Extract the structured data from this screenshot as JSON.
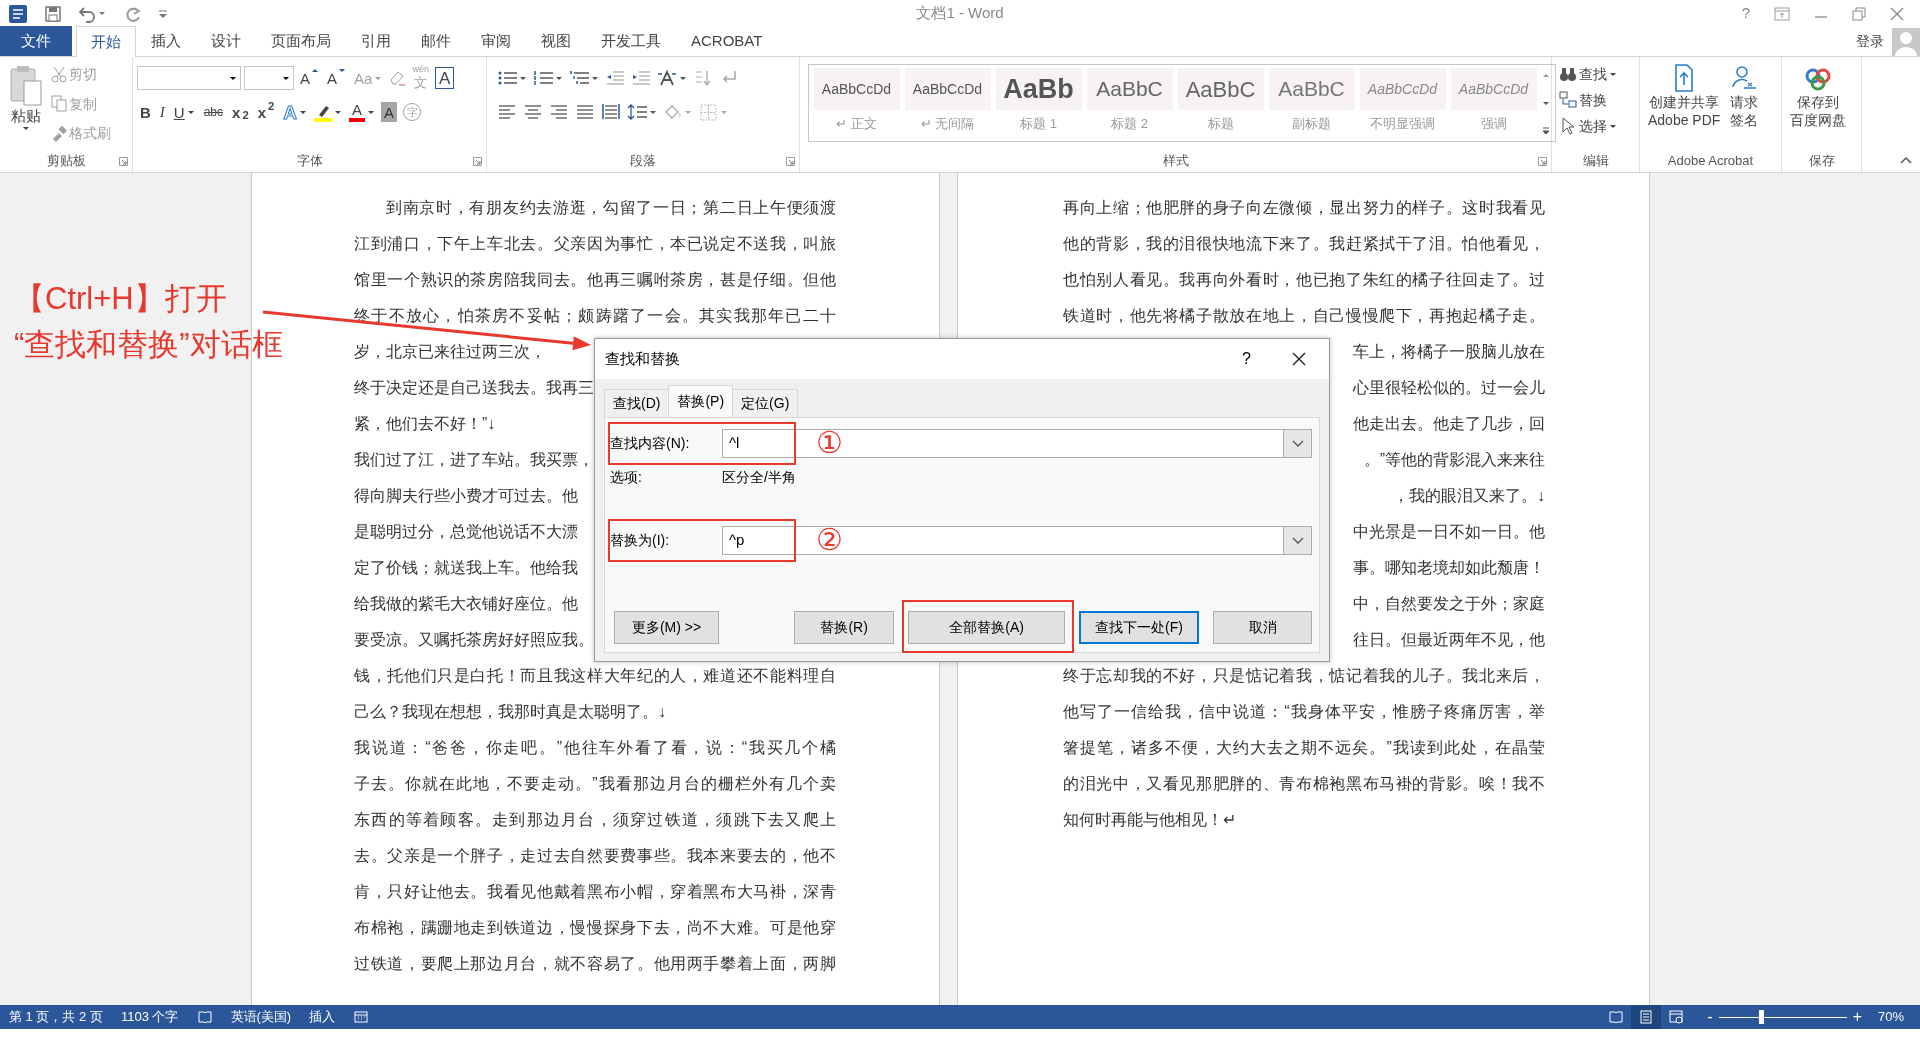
{
  "title_bar": {
    "title": "文档1 - Word",
    "help": "?"
  },
  "menu_tabs": [
    {
      "label": "文件",
      "kind": "file",
      "selected": false
    },
    {
      "label": "开始",
      "kind": "tab",
      "selected": true
    },
    {
      "label": "插入",
      "kind": "tab",
      "selected": false
    },
    {
      "label": "设计",
      "kind": "tab",
      "selected": false
    },
    {
      "label": "页面布局",
      "kind": "tab",
      "selected": false
    },
    {
      "label": "引用",
      "kind": "tab",
      "selected": false
    },
    {
      "label": "邮件",
      "kind": "tab",
      "selected": false
    },
    {
      "label": "审阅",
      "kind": "tab",
      "selected": false
    },
    {
      "label": "视图",
      "kind": "tab",
      "selected": false
    },
    {
      "label": "开发工具",
      "kind": "tab",
      "selected": false
    },
    {
      "label": "ACROBAT",
      "kind": "tab",
      "selected": false
    }
  ],
  "account": "登录",
  "clipboard": {
    "label": "剪贴板",
    "paste": "粘贴",
    "items": [
      {
        "label": "剪切",
        "kind": "cut",
        "disabled": true
      },
      {
        "label": "复制",
        "kind": "copy",
        "disabled": true
      },
      {
        "label": "格式刷",
        "kind": "painter",
        "disabled": true
      }
    ]
  },
  "font": {
    "label": "字体",
    "row1": [
      {
        "kind": "font_box",
        "disabled": false
      },
      {
        "kind": "size_box",
        "disabled": false
      },
      {
        "kind": "grow",
        "text": "A",
        "disabled": false
      },
      {
        "kind": "shrink",
        "text": "A",
        "disabled": false
      },
      {
        "kind": "case",
        "text": "Aa",
        "disabled": true
      },
      {
        "kind": "clear",
        "disabled": true
      },
      {
        "kind": "phonetic",
        "text": "wén",
        "sub": "文",
        "disabled": true
      },
      {
        "kind": "border",
        "text": "A",
        "disabled": false
      }
    ],
    "row2": [
      {
        "kind": "bold",
        "text": "B",
        "disabled": false
      },
      {
        "kind": "italic",
        "text": "I",
        "disabled": false
      },
      {
        "kind": "underline",
        "text": "U",
        "disabled": false
      },
      {
        "kind": "strike",
        "text": "abc",
        "disabled": false
      },
      {
        "kind": "sub",
        "text": "x$_{2}$",
        "disabled": false
      },
      {
        "kind": "sup",
        "text": "x$^{2}$",
        "disabled": false
      },
      {
        "kind": "effect",
        "text": "A",
        "disabled": false
      },
      {
        "kind": "highlight",
        "disabled": false
      },
      {
        "kind": "color",
        "text": "A",
        "disabled": false
      },
      {
        "kind": "shade",
        "text": "A",
        "disabled": false
      },
      {
        "kind": "enclose",
        "text": "字",
        "disabled": true
      }
    ]
  },
  "paragraph": {
    "label": "段落",
    "row1": [
      {
        "kind": "bullets",
        "disabled": false
      },
      {
        "kind": "numbering",
        "disabled": false
      },
      {
        "kind": "multilevel",
        "disabled": false
      },
      {
        "kind": "outdent",
        "disabled": true
      },
      {
        "kind": "indent",
        "disabled": true
      },
      {
        "kind": "asian",
        "disabled": false
      },
      {
        "kind": "sort",
        "disabled": true
      },
      {
        "kind": "marks",
        "disabled": true
      }
    ],
    "row2": [
      {
        "kind": "left",
        "disabled": false
      },
      {
        "kind": "center",
        "disabled": false
      },
      {
        "kind": "right",
        "disabled": false
      },
      {
        "kind": "justify",
        "disabled": false
      },
      {
        "kind": "distribute",
        "disabled": false
      },
      {
        "kind": "spacing",
        "disabled": false
      },
      {
        "kind": "shading",
        "disabled": true
      },
      {
        "kind": "borders",
        "disabled": true
      }
    ]
  },
  "styles": {
    "label": "样式",
    "items": [
      {
        "preview": "AaBbCcDd",
        "name": "↵ 正文",
        "kind": "normal"
      },
      {
        "preview": "AaBbCcDd",
        "name": "↵ 无间隔",
        "kind": "normal"
      },
      {
        "preview": "AaBb",
        "name": "标题 1",
        "kind": "h1"
      },
      {
        "preview": "AaBbC",
        "name": "标题 2",
        "kind": "h2"
      },
      {
        "preview": "AaBbC",
        "name": "标题",
        "kind": "title"
      },
      {
        "preview": "AaBbC",
        "name": "副标题",
        "kind": "subtitle"
      },
      {
        "preview": "AaBbCcDd",
        "name": "不明显强调",
        "kind": "emphasis"
      },
      {
        "preview": "AaBbCcDd",
        "name": "强调",
        "kind": "emphasis"
      }
    ]
  },
  "editing": {
    "label": "编辑",
    "items": [
      {
        "label": "查找",
        "kind": "find",
        "dropdown": true
      },
      {
        "label": "替换",
        "kind": "replace",
        "dropdown": false
      },
      {
        "label": "选择",
        "kind": "select",
        "dropdown": true
      }
    ]
  },
  "acrobat": {
    "label": "Adobe Acrobat",
    "items": [
      {
        "lines": [
          "创建并共享",
          "Adobe PDF"
        ],
        "kind": "pdf"
      },
      {
        "lines": [
          "请求",
          "签名"
        ],
        "kind": "sign"
      }
    ]
  },
  "save": {
    "label": "保存",
    "items": [
      {
        "lines": [
          "保存到",
          "百度网盘"
        ],
        "kind": "cloud"
      }
    ]
  },
  "pages": [
    {
      "lines": [
        {
          "text": "到南京时，有朋友约去游逛，勾留了一日；第二日上午便须渡",
          "kind": "first"
        },
        {
          "text": "江到浦口，下午上车北去。父亲因为事忙，本已说定不送我，叫旅",
          "kind": "full"
        },
        {
          "text": "馆里一个熟识的茶房陪我同去。他再三嘱咐茶房，甚是仔细。但他",
          "kind": "full"
        },
        {
          "text": "终于不放心，怕茶房不妥帖；颇踌躇了一会。其实我那年已二十",
          "kind": "full"
        },
        {
          "text": "岁，北京已来往过两三次，",
          "kind": "covered"
        },
        {
          "text": "终于决定还是自己送我去。我再三",
          "kind": "covered"
        },
        {
          "text": "紧，他们去不好！”↓",
          "kind": "end"
        },
        {
          "text": "我们过了江，进了车站。我买票，",
          "kind": "covered"
        },
        {
          "text": "得向脚夫行些小费才可过去。他",
          "kind": "covered"
        },
        {
          "text": "是聪明过分，总觉他说话不大漂",
          "kind": "covered"
        },
        {
          "text": "定了价钱；就送我上车。他给我",
          "kind": "covered"
        },
        {
          "text": "给我做的紫毛大衣铺好座位。他",
          "kind": "covered"
        },
        {
          "text": "要受凉。又嘱托茶房好好照应我。",
          "kind": "covered"
        },
        {
          "text": "钱，托他们只是白托！而且我这样大年纪的人，难道还不能料理自",
          "kind": "full"
        },
        {
          "text": "己么？我现在想想，我那时真是太聪明了。↓",
          "kind": "end"
        },
        {
          "text": "我说道：“爸爸，你走吧。”他往车外看了看，说：“我买几个橘",
          "kind": "full"
        },
        {
          "text": "子去。你就在此地，不要走动。”我看那边月台的栅栏外有几个卖",
          "kind": "full"
        },
        {
          "text": "东西的等着顾客。走到那边月台，须穿过铁道，须跳下去又爬上",
          "kind": "full"
        },
        {
          "text": "去。父亲是一个胖子，走过去自然要费事些。我本来要去的，他不",
          "kind": "full"
        },
        {
          "text": "肯，只好让他去。我看见他戴着黑布小帽，穿着黑布大马褂，深青",
          "kind": "full"
        },
        {
          "text": "布棉袍，蹒跚地走到铁道边，慢慢探身下去，尚不大难。可是他穿",
          "kind": "full"
        },
        {
          "text": "过铁道，要爬上那边月台，就不容易了。他用两手攀着上面，两脚",
          "kind": "full"
        }
      ]
    },
    {
      "lines": [
        {
          "text": "再向上缩；他肥胖的身子向左微倾，显出努力的样子。这时我看见",
          "kind": "full"
        },
        {
          "text": "他的背影，我的泪很快地流下来了。我赶紧拭干了泪。怕他看见，",
          "kind": "full"
        },
        {
          "text": "也怕别人看见。我再向外看时，他已抱了朱红的橘子往回走了。过",
          "kind": "full"
        },
        {
          "text": "铁道时，他先将橘子散放在地上，自己慢慢爬下，再抱起橘子走。",
          "kind": "full"
        },
        {
          "text": "车上，将橘子一股脑儿放在",
          "kind": "covered"
        },
        {
          "text": "心里很轻松似的。过一会儿",
          "kind": "covered"
        },
        {
          "text": "他走出去。他走了几步，回",
          "kind": "covered"
        },
        {
          "text": "。”等他的背影混入来来往",
          "kind": "covered"
        },
        {
          "text": "，我的眼泪又来了。↓",
          "kind": "covered"
        },
        {
          "text": "中光景是一日不如一日。他",
          "kind": "covered"
        },
        {
          "text": "事。哪知老境却如此颓唐！",
          "kind": "covered"
        },
        {
          "text": "中，自然要发之于外；家庭",
          "kind": "covered"
        },
        {
          "text": "往日。但最近两年不见，他",
          "kind": "covered"
        },
        {
          "text": "终于忘却我的不好，只是惦记着我，惦记着我的儿子。我北来后，",
          "kind": "full"
        },
        {
          "text": "他写了一信给我，信中说道：“我身体平安，惟膀子疼痛厉害，举",
          "kind": "full"
        },
        {
          "text": "箸提笔，诸多不便，大约大去之期不远矣。”我读到此处，在晶莹",
          "kind": "full"
        },
        {
          "text": "的泪光中，又看见那肥胖的、青布棉袍黑布马褂的背影。唉！我不",
          "kind": "full"
        },
        {
          "text": "知何时再能与他相见！↵",
          "kind": "end"
        }
      ]
    }
  ],
  "callout": {
    "lines": [
      "【Ctrl+H】打开",
      "“查找和替换”对话框"
    ]
  },
  "dialog": {
    "title": "查找和替换",
    "help": "?",
    "tabs": [
      {
        "label": "查找(D)",
        "selected": false
      },
      {
        "label": "替换(P)",
        "selected": true
      },
      {
        "label": "定位(G)",
        "selected": false
      }
    ],
    "find": {
      "label": "查找内容(N):",
      "value": "^l",
      "annotated": true,
      "marker": "①"
    },
    "options": {
      "label": "选项:",
      "value": "区分全/半角"
    },
    "replace": {
      "label": "替换为(I):",
      "value": "^p",
      "annotated": true,
      "marker": "②"
    },
    "buttons": [
      {
        "label": "更多(M) >>",
        "default": false,
        "annotated": false
      },
      {
        "label": "替换(R)",
        "default": false,
        "annotated": false
      },
      {
        "label": "全部替换(A)",
        "default": false,
        "annotated": true
      },
      {
        "label": "查找下一处(F)",
        "default": true,
        "annotated": false
      },
      {
        "label": "取消",
        "default": false,
        "annotated": false
      }
    ]
  },
  "status_bar": {
    "items": [
      {
        "kind": "text",
        "label": "第 1 页，共 2 页"
      },
      {
        "kind": "text",
        "label": "1103 个字"
      },
      {
        "kind": "proofing"
      },
      {
        "kind": "text",
        "label": "英语(美国)"
      },
      {
        "kind": "text",
        "label": "插入"
      },
      {
        "kind": "macro"
      }
    ],
    "views": [
      {
        "kind": "read",
        "selected": false
      },
      {
        "kind": "print",
        "selected": true
      },
      {
        "kind": "web",
        "selected": false
      }
    ],
    "zoom": {
      "minus": "-",
      "plus": "+",
      "level": 0.33,
      "reading": "70%"
    }
  }
}
